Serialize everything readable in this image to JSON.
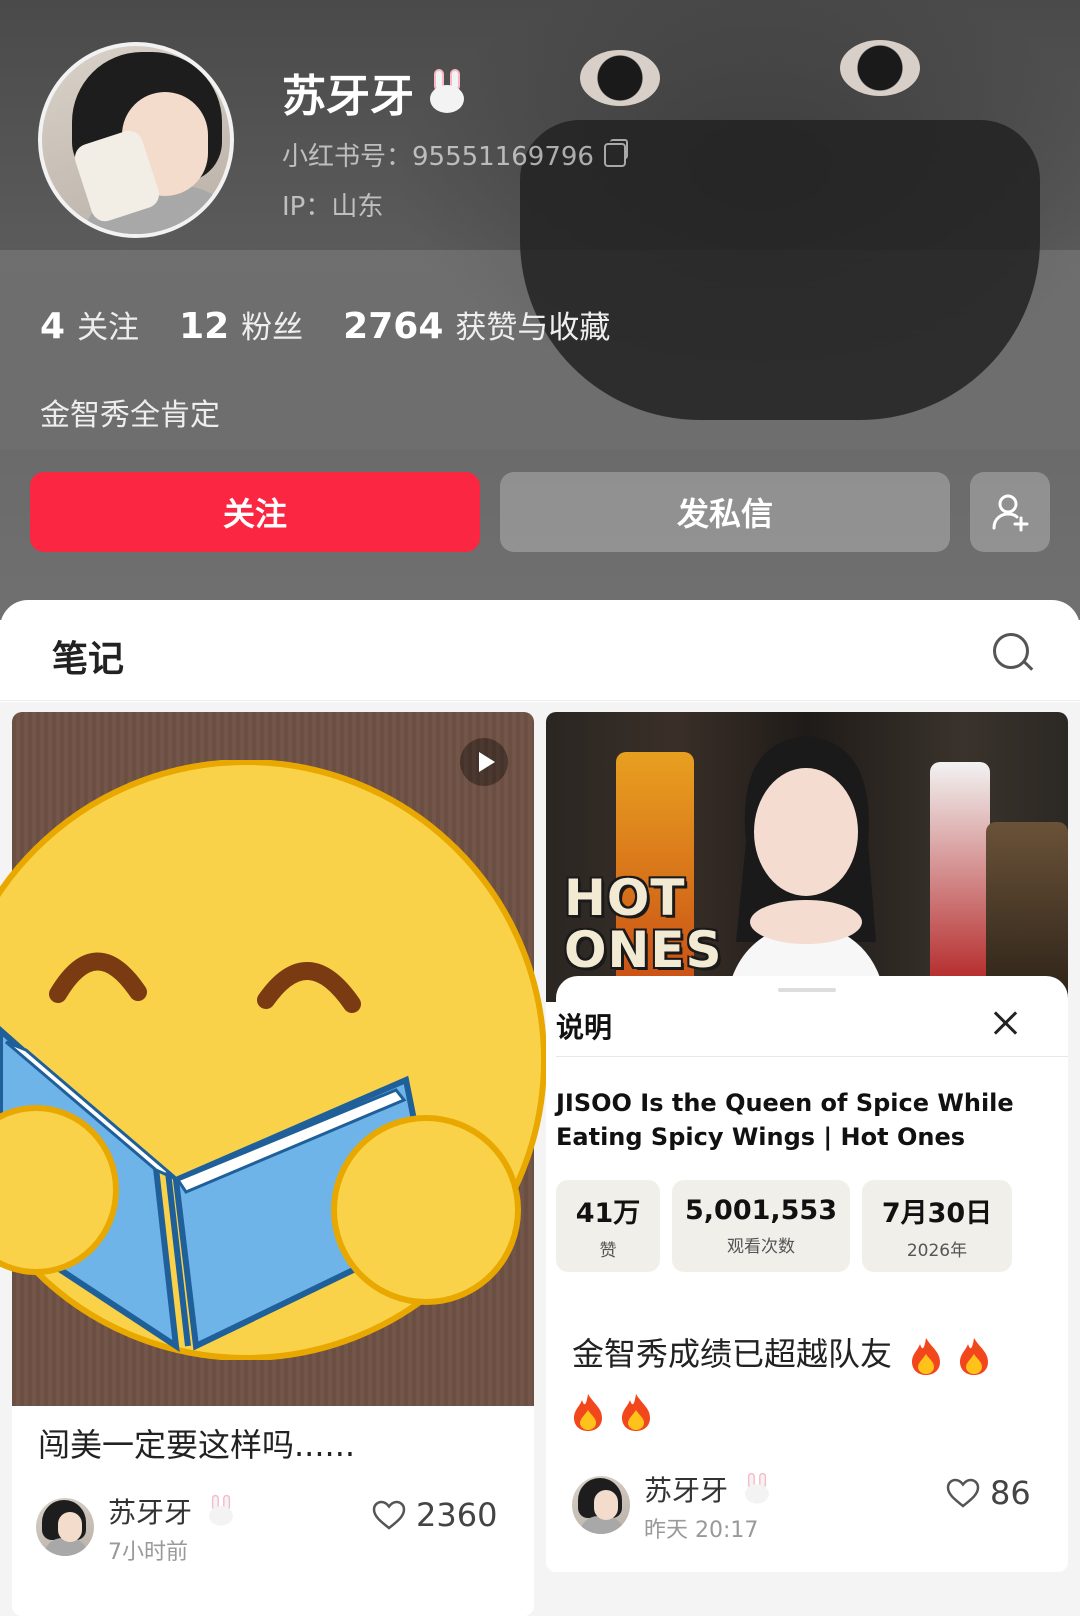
{
  "profile": {
    "name": "苏牙牙",
    "id_label": "小红书号：95551169796",
    "ip_label": "IP：山东",
    "stats": [
      {
        "value": "4",
        "label": "关注"
      },
      {
        "value": "12",
        "label": "粉丝"
      },
      {
        "value": "2764",
        "label": "获赞与收藏"
      }
    ],
    "bio": "金智秀全肯定",
    "follow_label": "关注",
    "message_label": "发私信"
  },
  "tabs": {
    "notes_label": "笔记"
  },
  "notes": [
    {
      "title": "闯美一定要这样吗......",
      "author": "苏牙牙",
      "time": "7小时前",
      "likes": "2360"
    },
    {
      "title": "金智秀成绩已超越队友",
      "author": "苏牙牙",
      "time": "昨天 20:17",
      "likes": "86",
      "video_logo_line1": "HOT",
      "video_logo_line2": "ONES",
      "sheet": {
        "title": "说明",
        "video_title": "JISOO Is the Queen of Spice While Eating Spicy Wings | Hot Ones",
        "chips": [
          {
            "value": "41万",
            "label": "赞"
          },
          {
            "value": "5,001,553",
            "label": "观看次数"
          },
          {
            "value": "7月30日",
            "label": "2026年"
          }
        ]
      }
    }
  ],
  "colors": {
    "follow_button": "#fb2642",
    "header_bg": "#5b5b5b"
  },
  "icons": [
    "copy-icon",
    "add-friend-icon",
    "search-icon",
    "play-icon",
    "close-icon",
    "heart-icon",
    "fire-icon",
    "bunny-icon"
  ]
}
